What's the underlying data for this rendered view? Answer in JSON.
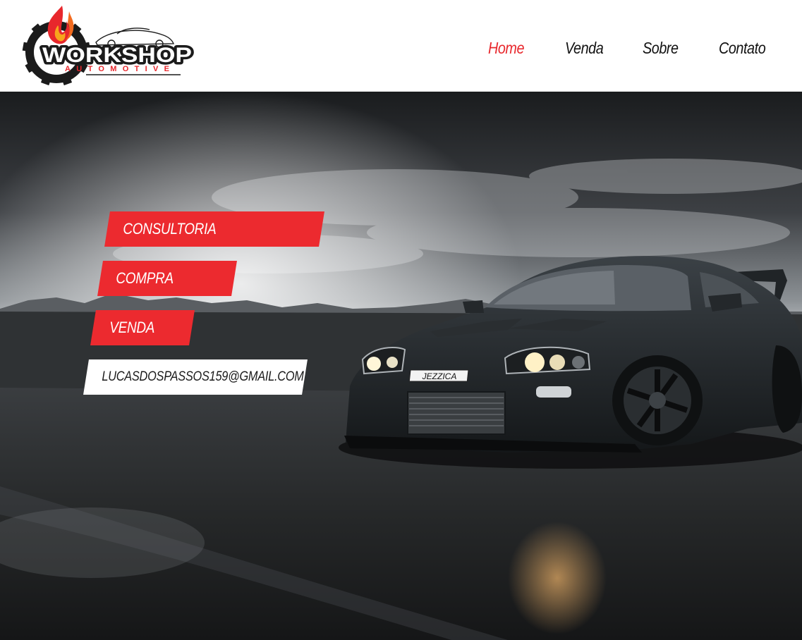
{
  "brand": {
    "logo_word": "WORKSHOP",
    "logo_sub": "AUTOMOTIVE"
  },
  "nav": {
    "items": [
      {
        "label": "Home",
        "active": true
      },
      {
        "label": "Venda",
        "active": false
      },
      {
        "label": "Sobre",
        "active": false
      },
      {
        "label": "Contato",
        "active": false
      }
    ]
  },
  "hero": {
    "buttons": {
      "consultoria": "CONSULTORIA",
      "compra": "COMPRA",
      "venda": "VENDA",
      "email": "LUCASDOSPASSOS159@GMAIL.COM"
    },
    "plate_text": "JEZZICA"
  },
  "colors": {
    "accent": "#ec2a2f",
    "nav_active": "#e8272c",
    "nav_text": "#111111"
  },
  "icons": {
    "logo_flame": "flame-icon",
    "logo_gear": "gear-icon",
    "logo_car": "car-outline-icon"
  }
}
